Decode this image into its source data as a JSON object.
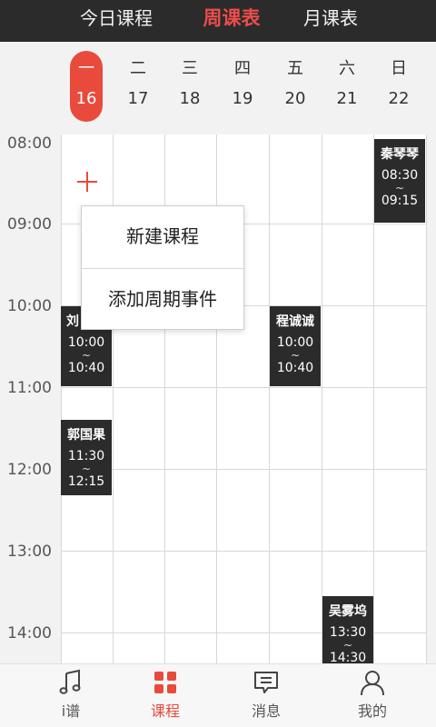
{
  "top_tabs": [
    {
      "label": "今日课程",
      "active": false
    },
    {
      "label": "周课表",
      "active": true
    },
    {
      "label": "月课表",
      "active": false
    }
  ],
  "days": [
    {
      "weekday": "一",
      "date": "16",
      "selected": true
    },
    {
      "weekday": "二",
      "date": "17"
    },
    {
      "weekday": "三",
      "date": "18"
    },
    {
      "weekday": "四",
      "date": "19"
    },
    {
      "weekday": "五",
      "date": "20"
    },
    {
      "weekday": "六",
      "date": "21"
    },
    {
      "weekday": "日",
      "date": "22"
    }
  ],
  "time_labels": [
    "08:00",
    "09:00",
    "10:00",
    "11:00",
    "12:00",
    "13:00",
    "14:00"
  ],
  "events": [
    {
      "name": "秦琴琴",
      "start": "08:30",
      "end": "09:15",
      "tilde": "~"
    },
    {
      "name": "刘",
      "start": "10:00",
      "end": "10:40",
      "tilde": "~"
    },
    {
      "name": "程诚诚",
      "start": "10:00",
      "end": "10:40",
      "tilde": "~"
    },
    {
      "name": "郭国果",
      "start": "11:30",
      "end": "12:15",
      "tilde": "~"
    },
    {
      "name": "吴雾坞",
      "start": "13:30",
      "end": "14:30",
      "tilde": "~"
    }
  ],
  "popup_menu": {
    "new_course": "新建课程",
    "add_periodic_event": "添加周期事件"
  },
  "bottom_nav": [
    {
      "label": "i谱",
      "icon": "music-note-icon",
      "active": false
    },
    {
      "label": "课程",
      "icon": "grid-icon",
      "active": true
    },
    {
      "label": "消息",
      "icon": "message-icon",
      "active": false
    },
    {
      "label": "我的",
      "icon": "person-icon",
      "active": false
    }
  ],
  "colors": {
    "accent": "#e84a3c",
    "topbar": "#2b2b2b",
    "event_bg": "#2b2b2b"
  }
}
